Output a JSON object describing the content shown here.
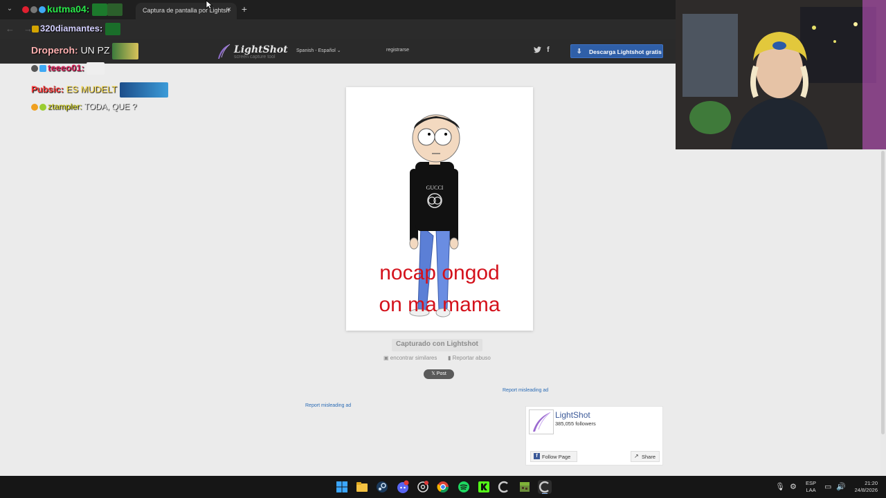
{
  "browser": {
    "tab_title": "Captura de pantalla por Lightsh",
    "tab_close": "×",
    "new_tab": "+",
    "chevron": "⌄",
    "back": "←",
    "forward": "→"
  },
  "header": {
    "logo_name": "LightShot",
    "logo_tagline": "screen capture tool",
    "language": "Spanish - Español",
    "register": "registrarse",
    "twitter_icon": "twitter-icon",
    "facebook_icon": "f",
    "download_button": "Descarga Lightshot gratis"
  },
  "screenshot": {
    "caption_line1": "nocap ongod",
    "caption_line2": "on ma mama",
    "shirt_text": "GUCCI"
  },
  "page": {
    "captured_label": "Capturado con Lightshot",
    "find_similar": "encontrar similares",
    "report_abuse": "Reportar abuso",
    "post_button": "Post",
    "report_ad_1": "Report misleading ad",
    "report_ad_2": "Report misleading ad"
  },
  "facebook_widget": {
    "page_name": "LightShot",
    "followers": "385,055 followers",
    "follow_button": "Follow Page",
    "share_button": "Share"
  },
  "chat": [
    {
      "user": "kutma04:",
      "message": ""
    },
    {
      "user": "320diamantes:",
      "message": ""
    },
    {
      "user": "Droperoh:",
      "message": "UN PZ"
    },
    {
      "user": "teeeo01:",
      "message": ""
    },
    {
      "user": "Pubsic:",
      "message": "ES MUDELT"
    },
    {
      "user": "ztampler:",
      "message": "TODA, QUE ?"
    }
  ],
  "taskbar": {
    "lang_line1": "ESP",
    "lang_line2": "LAA",
    "time": "21:20",
    "date": "24/8/2026"
  },
  "colors": {
    "accent": "#2f5fa8",
    "caption_red": "#d4121c",
    "page_bg": "#ebebeb"
  }
}
